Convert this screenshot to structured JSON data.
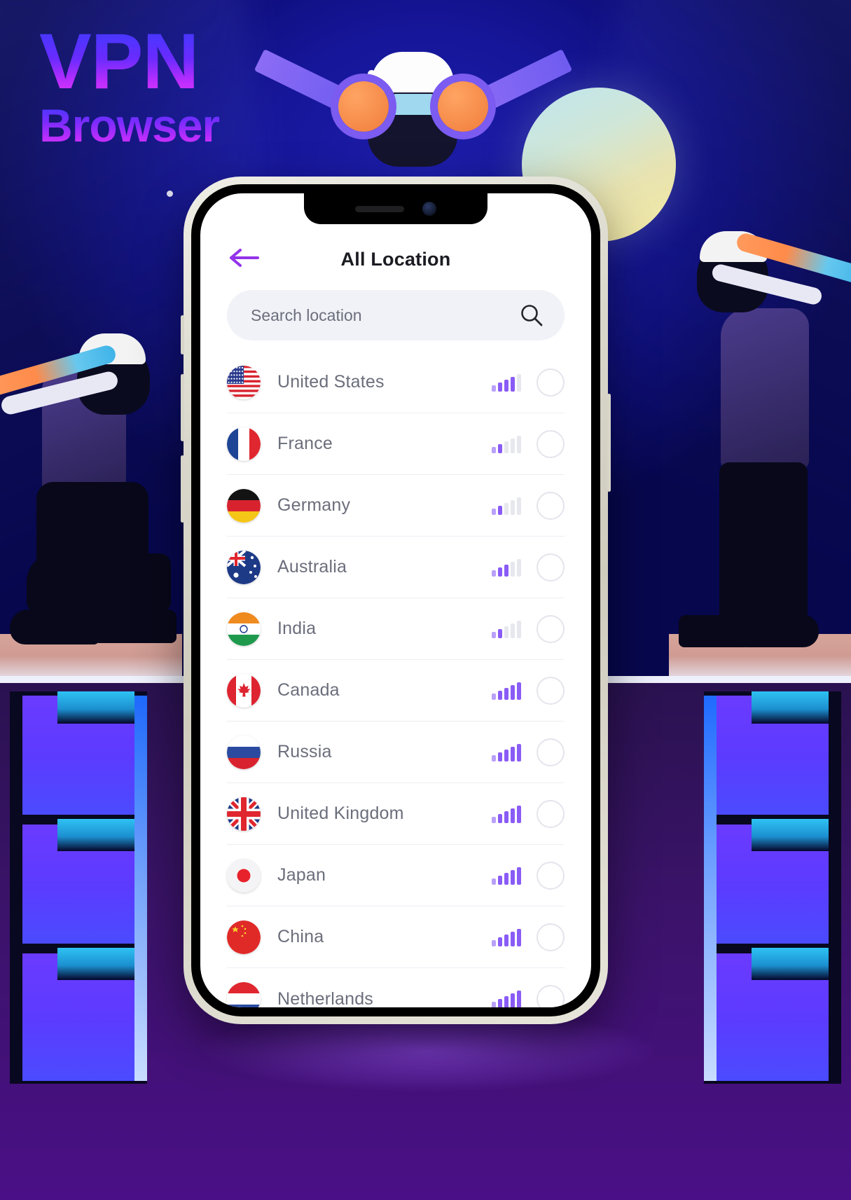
{
  "poster": {
    "title_main": "VPN",
    "title_sub": "Browser"
  },
  "phone": {
    "header": {
      "back_icon": "arrow-left-icon",
      "title": "All Location"
    },
    "search": {
      "placeholder": "Search location",
      "value": "",
      "icon": "search-icon"
    },
    "locations": [
      {
        "name": "United States",
        "flag": "us",
        "signal_bars": 4,
        "signal_total": 5,
        "selected": false
      },
      {
        "name": "France",
        "flag": "fr",
        "signal_bars": 2,
        "signal_total": 5,
        "selected": false
      },
      {
        "name": "Germany",
        "flag": "de",
        "signal_bars": 2,
        "signal_total": 5,
        "selected": false
      },
      {
        "name": "Australia",
        "flag": "au",
        "signal_bars": 3,
        "signal_total": 5,
        "selected": false
      },
      {
        "name": "India",
        "flag": "in",
        "signal_bars": 2,
        "signal_total": 5,
        "selected": false
      },
      {
        "name": "Canada",
        "flag": "ca",
        "signal_bars": 5,
        "signal_total": 5,
        "selected": false
      },
      {
        "name": "Russia",
        "flag": "ru",
        "signal_bars": 5,
        "signal_total": 5,
        "selected": false
      },
      {
        "name": "United Kingdom",
        "flag": "gb",
        "signal_bars": 5,
        "signal_total": 5,
        "selected": false
      },
      {
        "name": "Japan",
        "flag": "jp",
        "signal_bars": 5,
        "signal_total": 5,
        "selected": false
      },
      {
        "name": "China",
        "flag": "cn",
        "signal_bars": 5,
        "signal_total": 5,
        "selected": false
      },
      {
        "name": "Netherlands",
        "flag": "nl",
        "signal_bars": 5,
        "signal_total": 5,
        "selected": false
      }
    ]
  },
  "colors": {
    "accent_purple": "#8a5cf6",
    "back_arrow": "#9333ea",
    "title_gradient_start": "#3b3bff",
    "title_gradient_end": "#d83cff",
    "bg_deep_blue": "#0b0b6b",
    "band_purple": "#4a0f86",
    "search_bg": "#f1f2f7",
    "row_divider": "#eceef3",
    "name_text": "#6b6e7b"
  }
}
